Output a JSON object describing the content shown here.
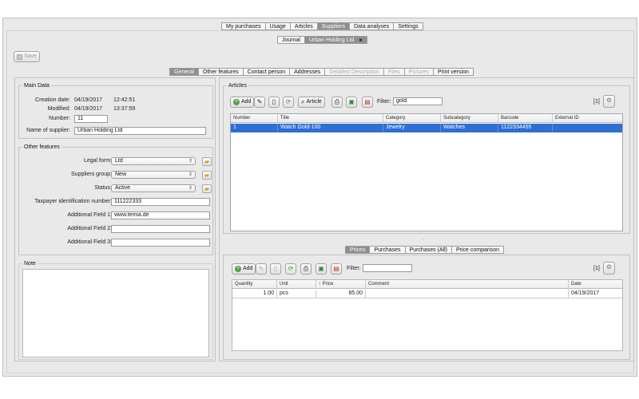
{
  "main_tabs": [
    {
      "label": "My purchases",
      "selected": false
    },
    {
      "label": "Usage",
      "selected": false
    },
    {
      "label": "Articles",
      "selected": false
    },
    {
      "label": "Suppliers",
      "selected": true
    },
    {
      "label": "Data analyses",
      "selected": false
    },
    {
      "label": "Settings",
      "selected": false
    }
  ],
  "sub_tabs": {
    "journal": "Journal",
    "supplier": "Urban Holding Ltd",
    "close": "✖"
  },
  "toolbar": {
    "save": "Save"
  },
  "detail_tabs": [
    {
      "label": "General",
      "state": "selected"
    },
    {
      "label": "Other features",
      "state": "normal"
    },
    {
      "label": "Contact person",
      "state": "normal"
    },
    {
      "label": "Addresses",
      "state": "normal"
    },
    {
      "label": "Detailed Description",
      "state": "disabled"
    },
    {
      "label": "Files",
      "state": "disabled"
    },
    {
      "label": "Pictures",
      "state": "disabled"
    },
    {
      "label": "Print version",
      "state": "normal"
    }
  ],
  "main_data": {
    "title": "Main Data",
    "creation_label": "Creation date:",
    "creation_date": "04/19/2017",
    "creation_time": "12:42:51",
    "modified_label": "Modified:",
    "modified_date": "04/19/2017",
    "modified_time": "13:37:59",
    "number_label": "Number:",
    "number": "11",
    "name_label": "Name of supplier:",
    "name": "Urban Holding Ltd"
  },
  "other_features": {
    "title": "Other features",
    "legal_form_label": "Legal form:",
    "legal_form": "Ltd",
    "group_label": "Suppliers group:",
    "group": "New",
    "status_label": "Status:",
    "status": "Active",
    "tax_label": "Taxpayer identification number:",
    "tax": "111222333",
    "add1_label": "Additional Field 1:",
    "add1": "www.temia.de",
    "add2_label": "Additional Field 2:",
    "add2": "",
    "add3_label": "Additional Field 3:",
    "add3": ""
  },
  "note": {
    "title": "Note",
    "text": ""
  },
  "articles": {
    "title": "Articles",
    "add_label": "Add",
    "article_label": "Article",
    "filter_label": "Filter:",
    "filter_value": "gold",
    "count": "[1]",
    "columns": [
      "Number",
      "Title",
      "Category",
      "Subcategory",
      "Barcode",
      "External ID"
    ],
    "rows": [
      {
        "number": "1",
        "title": "Watch Gold-100",
        "category": "Jewelry",
        "subcategory": "Watches",
        "barcode": "1122334455",
        "external_id": ""
      }
    ]
  },
  "splitter": "·",
  "price_tabs": [
    {
      "label": "Prices",
      "selected": true
    },
    {
      "label": "Purchases",
      "selected": false
    },
    {
      "label": "Purchases (All)",
      "selected": false
    },
    {
      "label": "Price comparison",
      "selected": false
    }
  ],
  "prices": {
    "add_label": "Add",
    "filter_label": "Filter:",
    "filter_value": "",
    "count": "[1]",
    "columns": [
      "Quantity",
      "Unit",
      "↑ Price",
      "Comment",
      "Date"
    ],
    "rows": [
      {
        "quantity": "1.00",
        "unit": "pcs",
        "price": "85.00",
        "comment": "",
        "date": "04/19/2017"
      }
    ]
  },
  "colors": {
    "selection": "#2e6fd1",
    "selected_tab": "#8f8f8f",
    "window_bg": "#e9e9e9"
  }
}
